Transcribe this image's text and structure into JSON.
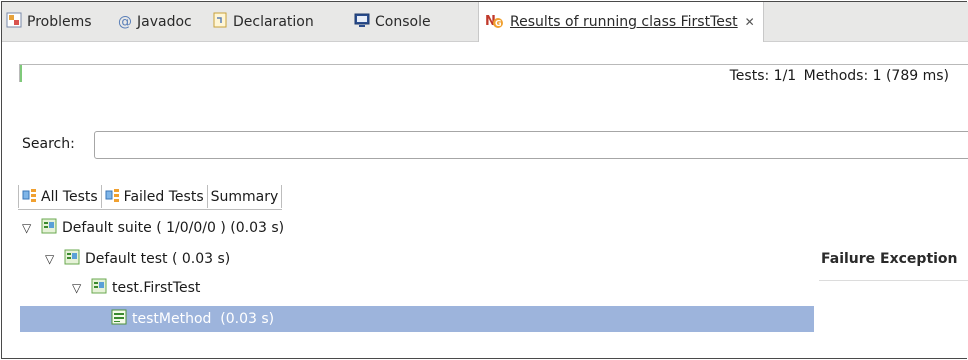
{
  "tabs": [
    {
      "label": "Problems",
      "icon": "problems-icon"
    },
    {
      "label": "Javadoc",
      "icon": "at-icon"
    },
    {
      "label": "Declaration",
      "icon": "declaration-icon"
    },
    {
      "label": "Console",
      "icon": "console-icon"
    },
    {
      "label": "Results of running class FirstTest",
      "icon": "testng-icon",
      "active": true
    }
  ],
  "progress": {
    "fraction": 1.0,
    "color": "#7fc97a"
  },
  "stats": {
    "tests": "Tests: 1/1",
    "methods": "Methods: 1 (789 ms)"
  },
  "search": {
    "label": "Search:",
    "value": ""
  },
  "result_tabs": [
    {
      "label": "All Tests",
      "icon": "tree-icon"
    },
    {
      "label": "Failed Tests",
      "icon": "tree-icon"
    },
    {
      "label": "Summary"
    }
  ],
  "tree": [
    {
      "label": "Default suite ( 1/0/0/0 ) (0.03 s)",
      "expanded": true,
      "icon": "suite-pass-icon"
    },
    {
      "label": "Default test ( 0.03 s)",
      "expanded": true,
      "icon": "test-pass-icon"
    },
    {
      "label": "test.FirstTest",
      "expanded": true,
      "icon": "class-pass-icon"
    },
    {
      "label": "testMethod  (0.03 s)",
      "icon": "method-pass-icon",
      "selected": true
    }
  ],
  "failure": {
    "label": "Failure Exception"
  },
  "colors": {
    "selection": "#9db4dc",
    "progress": "#7fc97a",
    "tabbar": "#e8e8e7"
  }
}
